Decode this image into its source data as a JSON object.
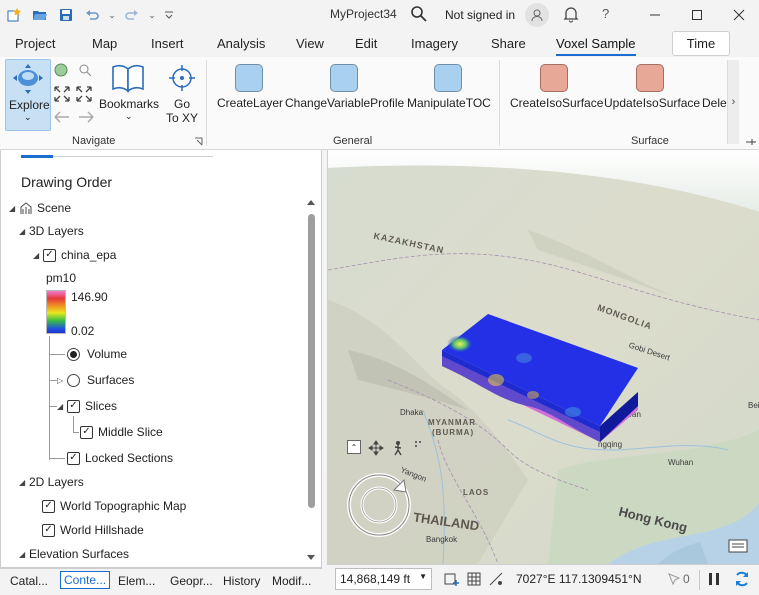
{
  "title_bar": {
    "project_name": "MyProject34",
    "sign_in_status": "Not signed in",
    "help_label": "?"
  },
  "ribbon_tabs": [
    "Project",
    "Map",
    "Insert",
    "Analysis",
    "View",
    "Edit",
    "Imagery",
    "Share",
    "Voxel Sample"
  ],
  "ribbon_tab_time": "Time",
  "ribbon": {
    "navigate": {
      "explore_label": "Explore",
      "bookmarks_label": "Bookmarks",
      "goto_label_1": "Go",
      "goto_label_2": "To XY",
      "group_label": "Navigate"
    },
    "general": {
      "buttons": [
        "CreateLayer",
        "ChangeVariableProfile",
        "ManipulateTOC"
      ],
      "group_label": "General"
    },
    "surface": {
      "buttons": [
        "CreateIsoSurface",
        "UpdateIsoSurface",
        "Dele"
      ],
      "group_label": "Surface"
    }
  },
  "contents_panel": {
    "title": "Drawing Order",
    "scene": "Scene",
    "layers_3d": "3D Layers",
    "layer_name": "china_epa",
    "variable": "pm10",
    "legend_max": "146.90",
    "legend_min": "0.02",
    "volume": "Volume",
    "surfaces": "Surfaces",
    "slices": "Slices",
    "middle_slice": "Middle Slice",
    "locked_sections": "Locked Sections",
    "layers_2d": "2D Layers",
    "topo_map": "World Topographic Map",
    "hillshade": "World Hillshade",
    "elevation": "Elevation Surfaces"
  },
  "bottom_tabs": [
    "Catal...",
    "Conte...",
    "Elem...",
    "Geopr...",
    "History",
    "Modif..."
  ],
  "bottom_tab_active_index": 1,
  "map": {
    "labels": {
      "kazakhstan": "KAZAKHSTAN",
      "mongolia": "MONGOLIA",
      "gobi": "Gobi Desert",
      "beijing": "Beijing",
      "wuhan": "Wuhan",
      "dhaka": "Dhaka",
      "myanmar": "MYANMAR",
      "burma": "(BURMA)",
      "yangon": "Yangon",
      "laos": "LAOS",
      "thailand": "THAILAND",
      "bangkok": "Bangkok",
      "hongkong": "Hong Kong",
      "tan": "Tan",
      "ngqing": "ngqing"
    },
    "voxel_colors": {
      "top": "#2330e6",
      "front": "#1d2bd0",
      "side": "#101a9a",
      "bottom_band": "#d070d8"
    }
  },
  "status_bar": {
    "scale": "14,868,149 ft",
    "coordinates": "7027°E 117.1309451°N",
    "selection_count": "0"
  }
}
